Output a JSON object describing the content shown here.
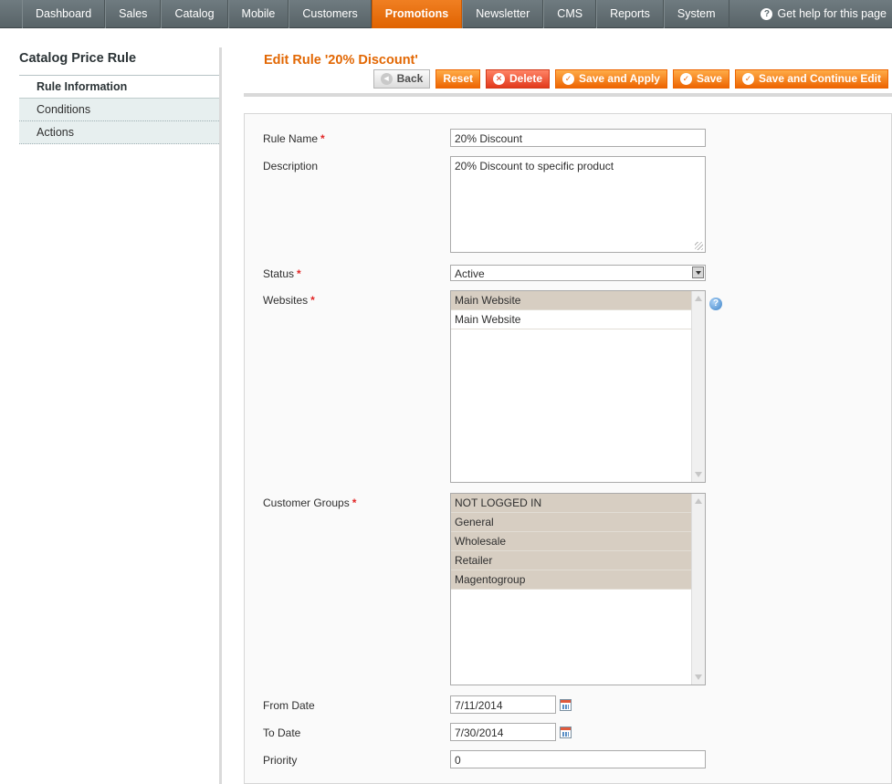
{
  "nav": {
    "items": [
      "Dashboard",
      "Sales",
      "Catalog",
      "Mobile",
      "Customers",
      "Promotions",
      "Newsletter",
      "CMS",
      "Reports",
      "System"
    ],
    "active": "Promotions",
    "help_label": "Get help for this page"
  },
  "sidebar": {
    "title": "Catalog Price Rule",
    "tabs": [
      {
        "label": "Rule Information",
        "active": true
      },
      {
        "label": "Conditions",
        "active": false
      },
      {
        "label": "Actions",
        "active": false
      }
    ]
  },
  "header": {
    "title": "Edit Rule '20% Discount'",
    "buttons": {
      "back": "Back",
      "reset": "Reset",
      "delete": "Delete",
      "save_apply": "Save and Apply",
      "save": "Save",
      "save_continue": "Save and Continue Edit"
    }
  },
  "form": {
    "rule_name": {
      "label": "Rule Name",
      "value": "20% Discount"
    },
    "description": {
      "label": "Description",
      "value": "20% Discount to specific product"
    },
    "status": {
      "label": "Status",
      "value": "Active"
    },
    "websites": {
      "label": "Websites",
      "options": [
        {
          "label": "Main Website",
          "selected": true
        },
        {
          "label": "Main Website",
          "selected": false
        }
      ]
    },
    "customer_groups": {
      "label": "Customer Groups",
      "options": [
        {
          "label": "NOT LOGGED IN",
          "selected": true
        },
        {
          "label": "General",
          "selected": true
        },
        {
          "label": "Wholesale",
          "selected": true
        },
        {
          "label": "Retailer",
          "selected": true
        },
        {
          "label": "Magentogroup",
          "selected": true
        }
      ]
    },
    "from_date": {
      "label": "From Date",
      "value": "7/11/2014"
    },
    "to_date": {
      "label": "To Date",
      "value": "7/30/2014"
    },
    "priority": {
      "label": "Priority",
      "value": "0"
    }
  },
  "colors": {
    "accent_orange": "#ed6502",
    "title_orange": "#e26703",
    "delete_red": "#e2391c",
    "selected_option": "#d7cec2",
    "nav_bg": "#5f6a6e"
  },
  "icons": [
    "help-icon",
    "back-arrow-icon",
    "delete-x-icon",
    "checkmark-icon",
    "calendar-icon",
    "info-icon",
    "resize-grip-icon"
  ]
}
